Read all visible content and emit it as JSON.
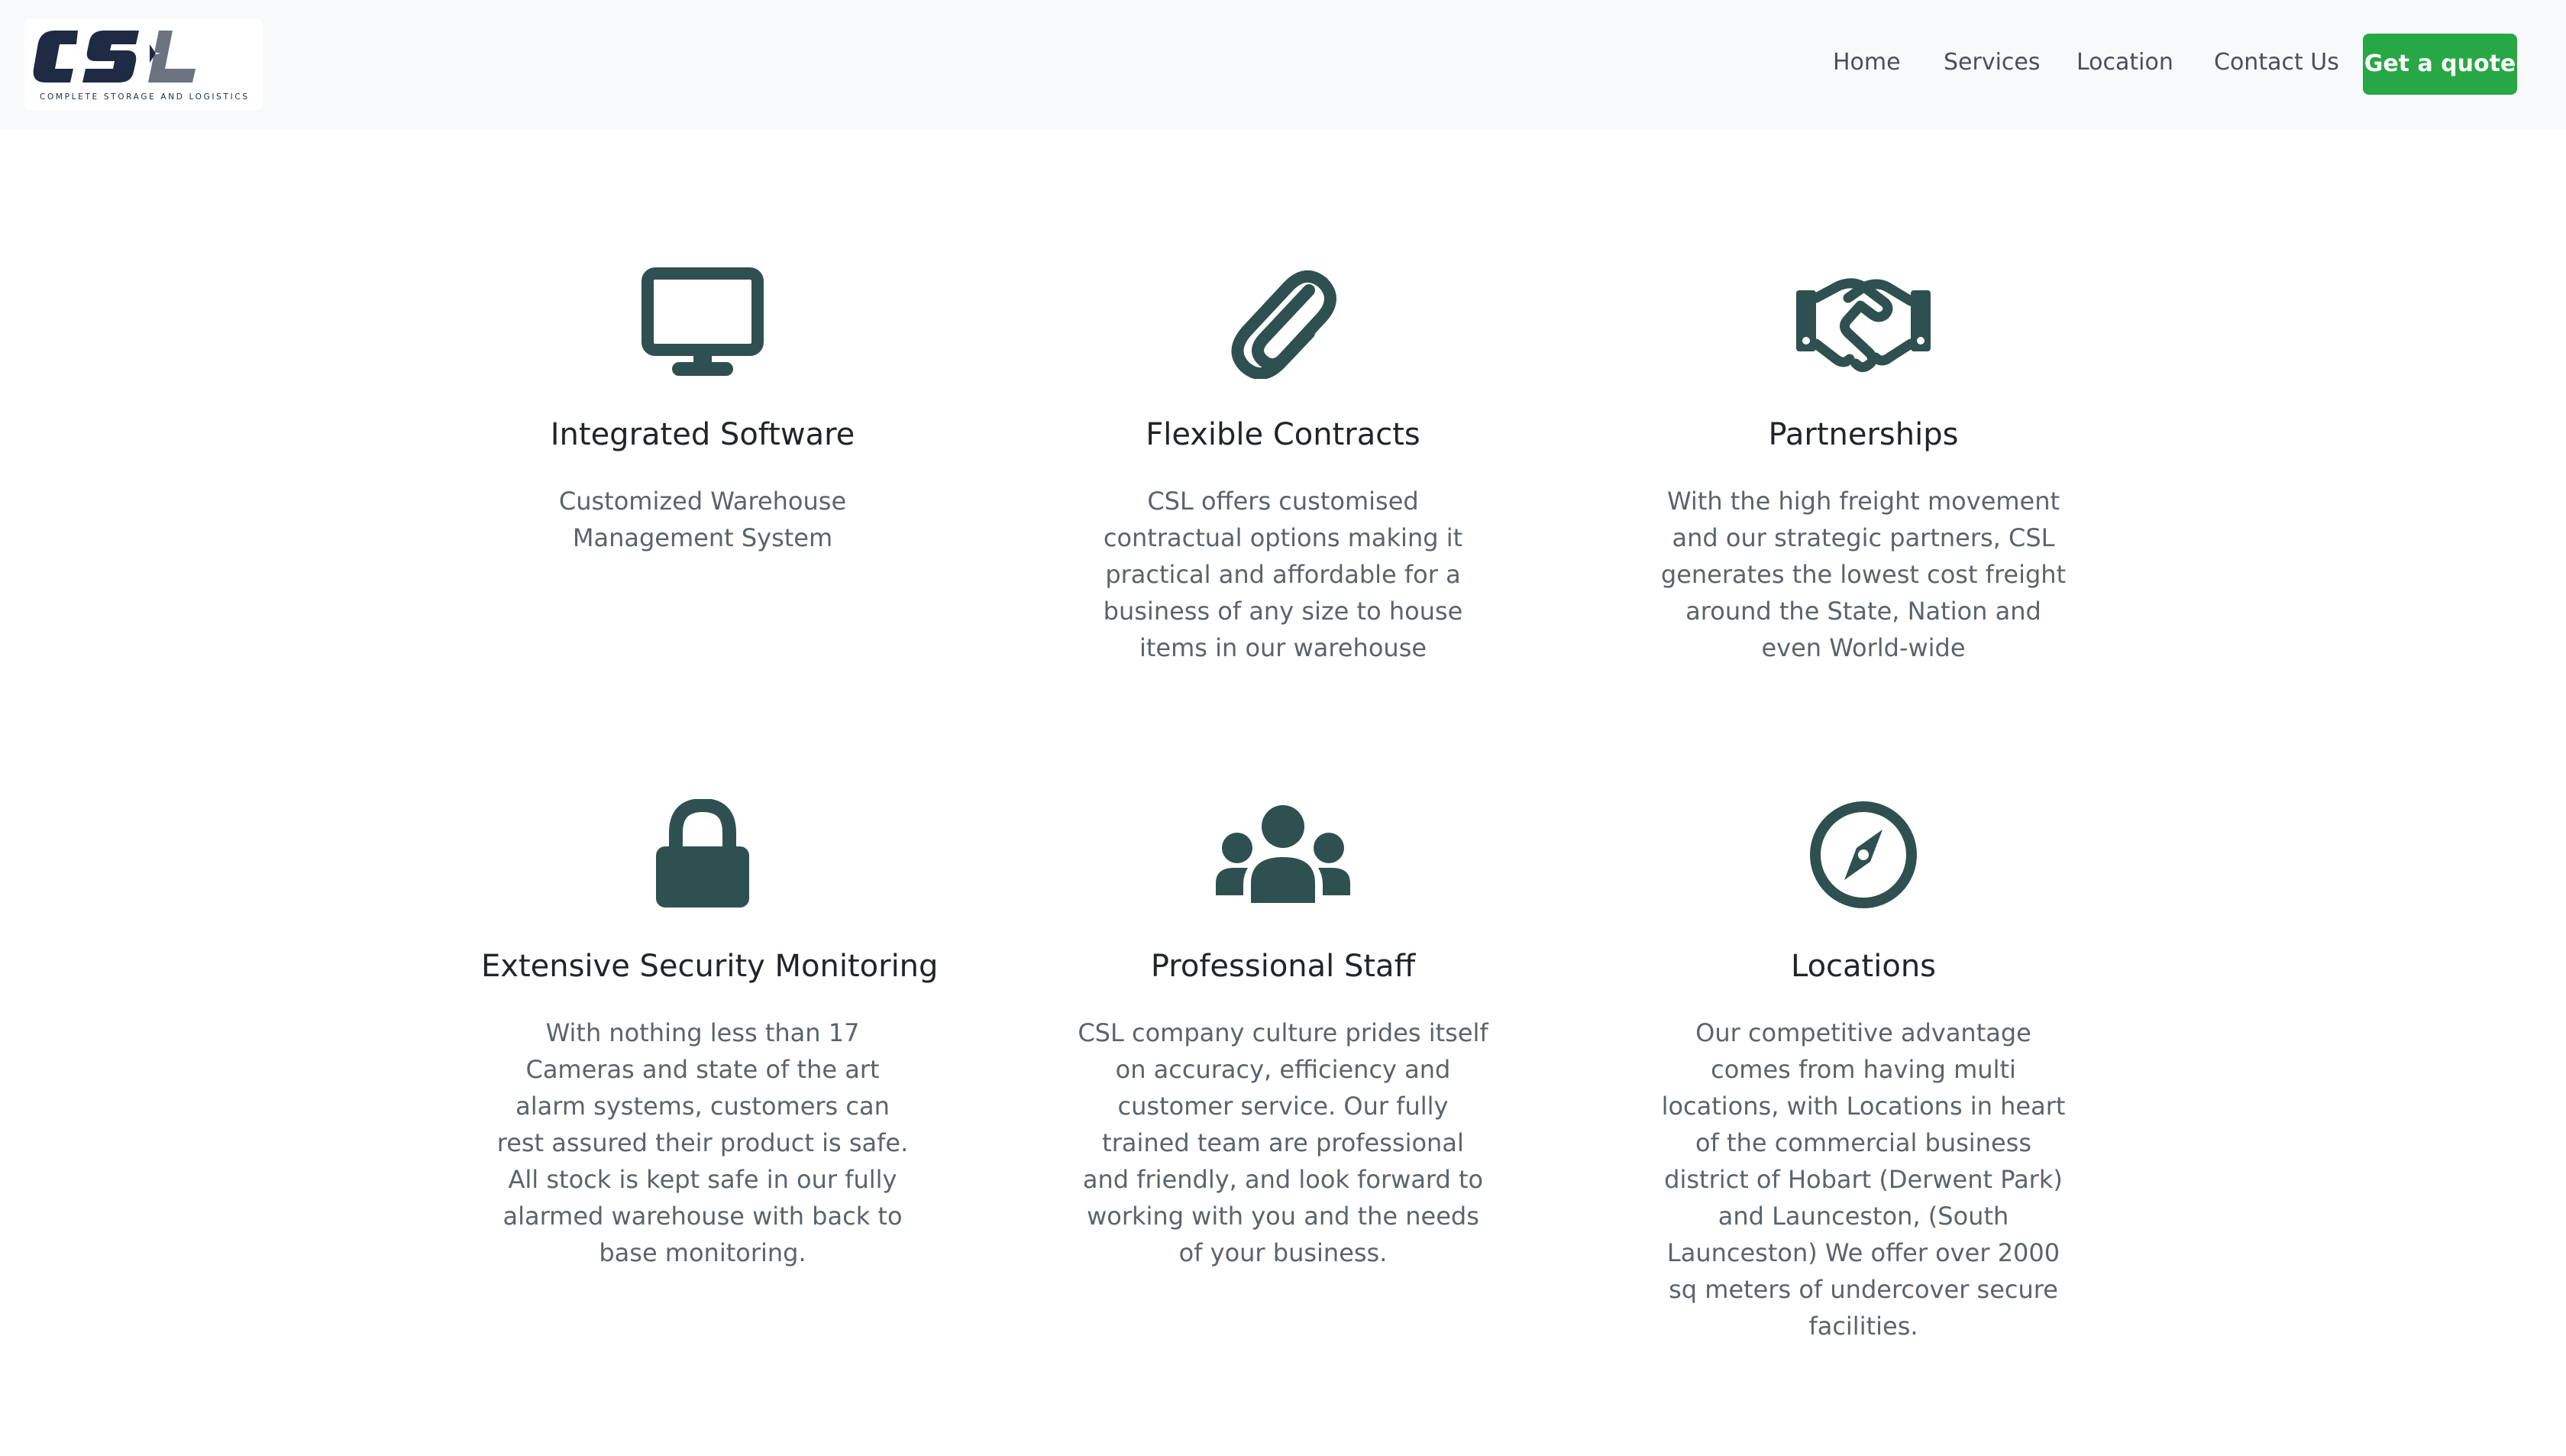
{
  "brand": {
    "logo_text": "CSL",
    "logo_tagline": "COMPLETE STORAGE AND LOGISTICS"
  },
  "nav": {
    "items": [
      {
        "label": "Home"
      },
      {
        "label": "Services"
      },
      {
        "label": "Location"
      },
      {
        "label": "Contact Us"
      }
    ],
    "cta_label": "Get a quote"
  },
  "colors": {
    "icon": "#2f5050",
    "nav_background": "#f8f9fa",
    "cta_background": "#28a745"
  },
  "features": [
    {
      "icon": "monitor-icon",
      "title": "Integrated Software",
      "description": "Customized Warehouse Management System"
    },
    {
      "icon": "paperclip-icon",
      "title": "Flexible Contracts",
      "description": "CSL offers customised contractual options making it practical and affordable for a business of any size to house items in our warehouse"
    },
    {
      "icon": "handshake-icon",
      "title": "Partnerships",
      "description": "With the high freight movement and our strategic partners, CSL generates the lowest cost freight around the State, Nation and even World-wide"
    },
    {
      "icon": "lock-icon",
      "title": "Extensive Security Monitoring",
      "description": "With nothing less than 17 Cameras and state of the art alarm systems, customers can rest assured their product is safe. All stock is kept safe in our fully alarmed warehouse with back to base monitoring."
    },
    {
      "icon": "people-icon",
      "title": "Professional Staff",
      "description": "CSL company culture prides itself on accuracy, efficiency and customer service. Our fully trained team are professional and friendly, and look forward to working with you and the needs of your business."
    },
    {
      "icon": "compass-icon",
      "title": "Locations",
      "description": "Our competitive advantage comes from having multi locations, with Locations in heart of the commercial business district of Hobart (Derwent Park) and Launceston, (South Launceston) We offer over 2000 sq meters of undercover secure facilities."
    }
  ]
}
